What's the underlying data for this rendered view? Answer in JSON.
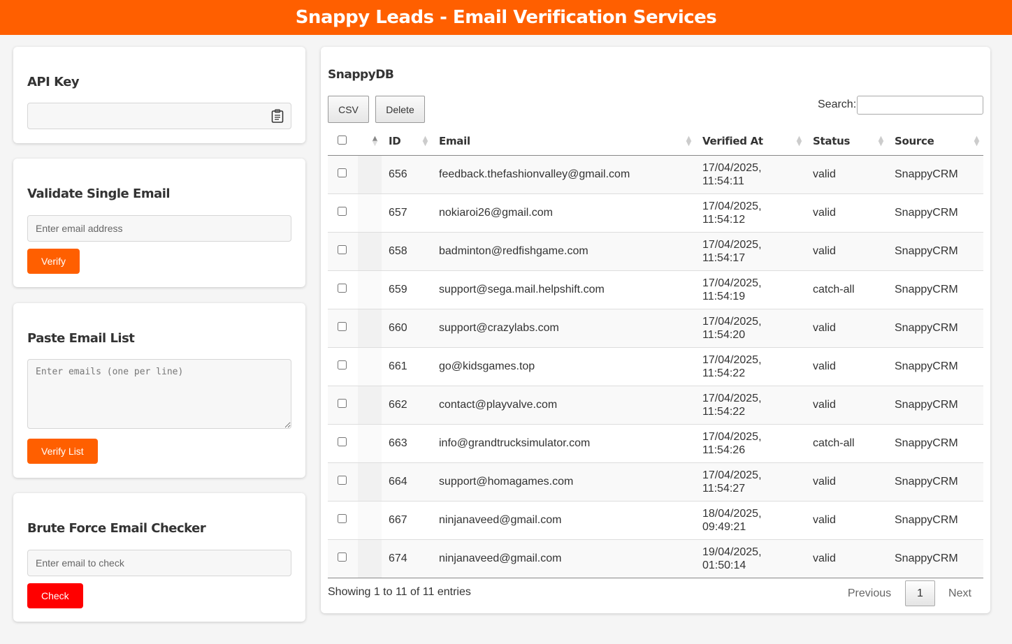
{
  "header": {
    "title": "Snappy Leads - Email Verification Services"
  },
  "api_key": {
    "title": "API Key",
    "value": "",
    "clipboard_icon": "clipboard-icon"
  },
  "single": {
    "title": "Validate Single Email",
    "placeholder": "Enter email address",
    "button": "Verify"
  },
  "paste": {
    "title": "Paste Email List",
    "placeholder": "Enter emails (one per line)",
    "button": "Verify List"
  },
  "brute": {
    "title": "Brute Force Email Checker",
    "placeholder": "Enter email to check",
    "button": "Check"
  },
  "db": {
    "title": "SnappyDB",
    "csv_button": "CSV",
    "delete_button": "Delete",
    "search_label": "Search:",
    "search_value": "",
    "columns": [
      "ID",
      "Email",
      "Verified At",
      "Status",
      "Source"
    ],
    "rows": [
      {
        "id": "656",
        "email": "feedback.thefashionvalley@gmail.com",
        "date": "17/04/2025,",
        "time": "11:54:11",
        "status": "valid",
        "source": "SnappyCRM"
      },
      {
        "id": "657",
        "email": "nokiaroi26@gmail.com",
        "date": "17/04/2025,",
        "time": "11:54:12",
        "status": "valid",
        "source": "SnappyCRM"
      },
      {
        "id": "658",
        "email": "badminton@redfishgame.com",
        "date": "17/04/2025,",
        "time": "11:54:17",
        "status": "valid",
        "source": "SnappyCRM"
      },
      {
        "id": "659",
        "email": "support@sega.mail.helpshift.com",
        "date": "17/04/2025,",
        "time": "11:54:19",
        "status": "catch-all",
        "source": "SnappyCRM"
      },
      {
        "id": "660",
        "email": "support@crazylabs.com",
        "date": "17/04/2025,",
        "time": "11:54:20",
        "status": "valid",
        "source": "SnappyCRM"
      },
      {
        "id": "661",
        "email": "go@kidsgames.top",
        "date": "17/04/2025,",
        "time": "11:54:22",
        "status": "valid",
        "source": "SnappyCRM"
      },
      {
        "id": "662",
        "email": "contact@playvalve.com",
        "date": "17/04/2025,",
        "time": "11:54:22",
        "status": "valid",
        "source": "SnappyCRM"
      },
      {
        "id": "663",
        "email": "info@grandtrucksimulator.com",
        "date": "17/04/2025,",
        "time": "11:54:26",
        "status": "catch-all",
        "source": "SnappyCRM"
      },
      {
        "id": "664",
        "email": "support@homagames.com",
        "date": "17/04/2025,",
        "time": "11:54:27",
        "status": "valid",
        "source": "SnappyCRM"
      },
      {
        "id": "667",
        "email": "ninjanaveed@gmail.com",
        "date": "18/04/2025,",
        "time": "09:49:21",
        "status": "valid",
        "source": "SnappyCRM"
      },
      {
        "id": "674",
        "email": "ninjanaveed@gmail.com",
        "date": "19/04/2025,",
        "time": "01:50:14",
        "status": "valid",
        "source": "SnappyCRM"
      }
    ],
    "info": "Showing 1 to 11 of 11 entries",
    "pagination": {
      "previous": "Previous",
      "current": "1",
      "next": "Next"
    }
  },
  "colors": {
    "brand": "#ff5f00",
    "danger": "#ff0000"
  }
}
